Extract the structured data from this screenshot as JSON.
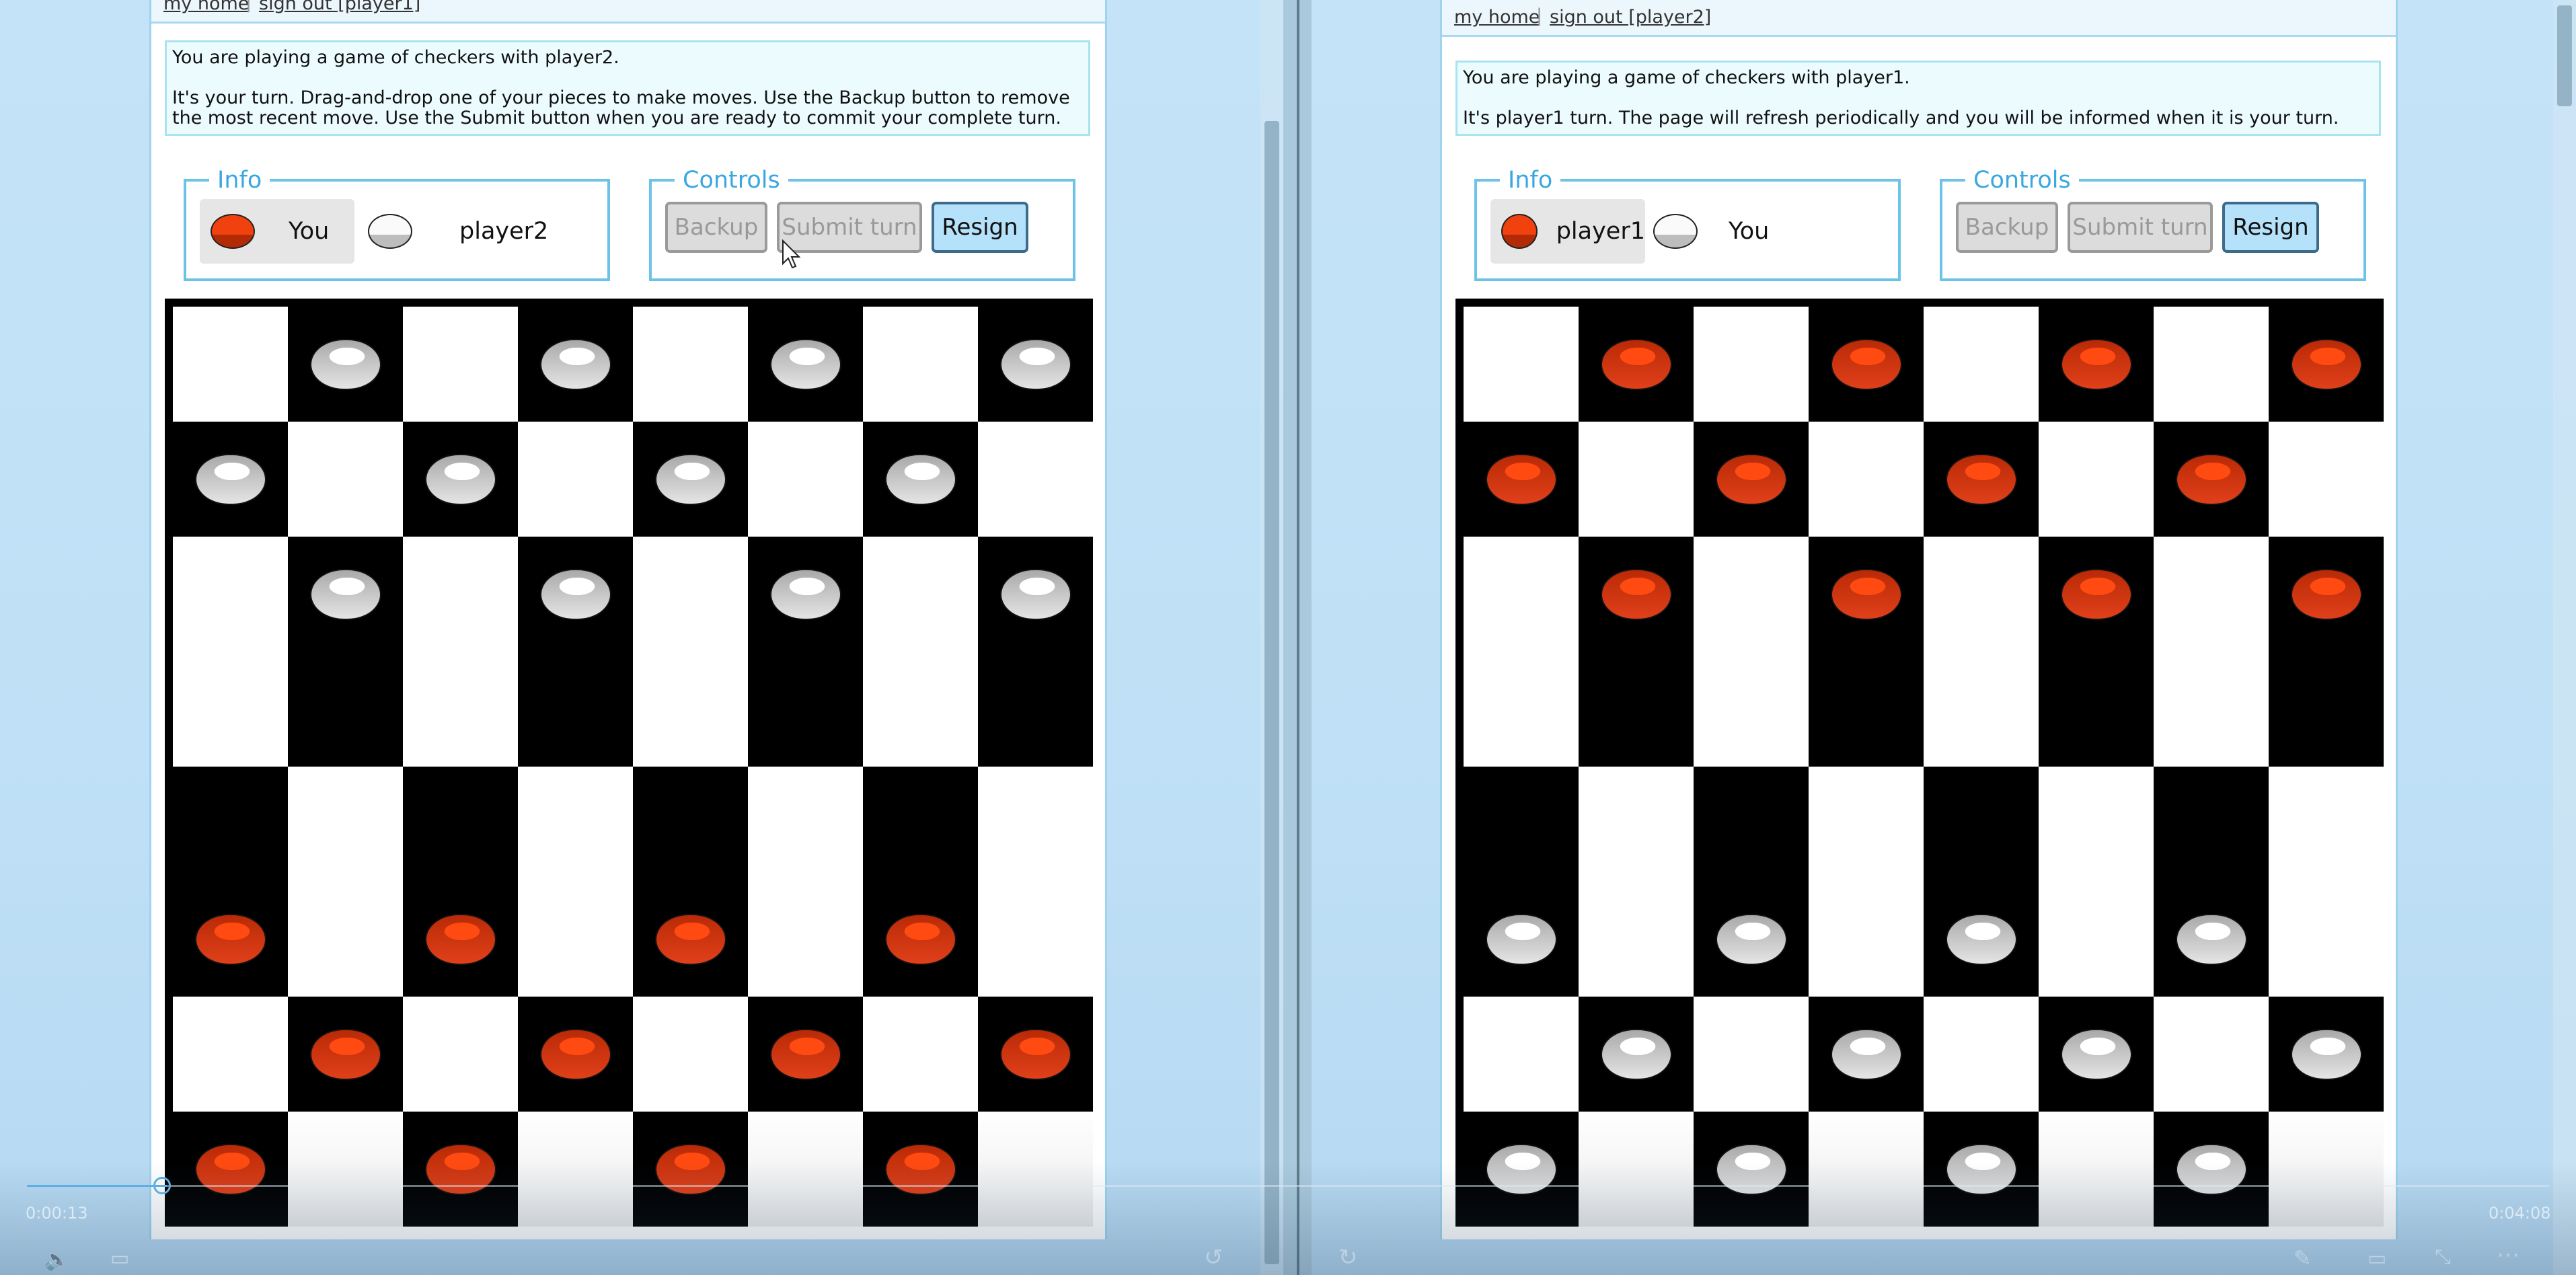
{
  "left": {
    "topbar": {
      "my_home": "my home",
      "sep": "|",
      "sign_out": "sign out [player1]"
    },
    "message": {
      "line1": "You are playing a game of checkers with player2.",
      "line2": "It's your turn. Drag-and-drop one of your pieces to make moves. Use the Backup button to remove the most recent move. Use the Submit button when you are ready to commit your complete turn."
    },
    "info": {
      "legend": "Info",
      "p1_label": "You",
      "p2_label": "player2"
    },
    "controls": {
      "legend": "Controls",
      "backup": "Backup",
      "submit": "Submit turn",
      "resign": "Resign"
    },
    "board": [
      ".w.w.w.w",
      "w.w.w.w.",
      ".w.w.w.w",
      "........",
      "........",
      "r.r.r.r.",
      ".r.r.r.r",
      "r.r.r.r."
    ]
  },
  "right": {
    "topbar": {
      "my_home": "my home",
      "sep": "|",
      "sign_out": "sign out [player2]"
    },
    "message": {
      "line1": "You are playing a game of checkers with player1.",
      "line2": "It's player1 turn. The page will refresh periodically and you will be informed when it is your turn."
    },
    "info": {
      "legend": "Info",
      "p1_label": "player1",
      "p2_label": "You"
    },
    "controls": {
      "legend": "Controls",
      "backup": "Backup",
      "submit": "Submit turn",
      "resign": "Resign"
    },
    "board": [
      ".r.r.r.r",
      "r.r.r.r.",
      ".r.r.r.r",
      "........",
      "........",
      "w.w.w.w.",
      ".w.w.w.w",
      "w.w.w.w."
    ]
  },
  "video": {
    "time_elapsed": "0:00:13",
    "time_total": "0:04:08"
  },
  "colors": {
    "red_piece": "#f0410f",
    "white_piece": "#ffffff",
    "accent": "#3aa8e0"
  }
}
